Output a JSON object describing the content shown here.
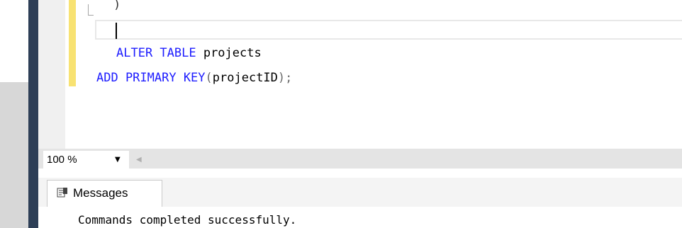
{
  "editor": {
    "fold_paren": ")",
    "line1": {
      "kw": "ALTER TABLE",
      "ident": " projects"
    },
    "line2": {
      "kw1": "ADD PRIMARY KEY",
      "open": "(",
      "ident": "projectID",
      "close": ");"
    }
  },
  "status": {
    "zoom": "100 %"
  },
  "results": {
    "tab_label": "Messages",
    "message": "Commands completed successfully."
  },
  "icons": {
    "zoom_dropdown": "chevron-down-icon",
    "scroll_left": "scroll-left-icon",
    "messages": "messages-icon"
  }
}
